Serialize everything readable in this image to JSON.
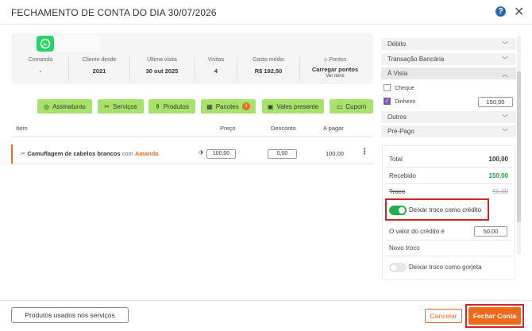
{
  "header": {
    "title": "FECHAMENTO DE CONTA DO DIA 30/07/2026",
    "help": "?",
    "close": "✕"
  },
  "client_card": {
    "stats": [
      {
        "label": "Comanda",
        "value": "-"
      },
      {
        "label": "Cliente desde",
        "value": "2021"
      },
      {
        "label": "Última visita",
        "value": "30 out 2025"
      },
      {
        "label": "Visitas",
        "value": "4"
      },
      {
        "label": "Gasto médio",
        "value": "R$ 192,50"
      }
    ],
    "points_label": "Pontos",
    "points_load": "Carregar pontos",
    "points_link": "Ver itens"
  },
  "actions": {
    "assinaturas": "Assinaturas",
    "servicos": "Serviços",
    "produtos": "Produtos",
    "pacotes": "Pacotes",
    "pacotes_count": "3",
    "vales": "Vales presente",
    "cupom": "Cupom"
  },
  "table": {
    "headers": {
      "item": "Item",
      "preco": "Preço",
      "desconto": "Desconto",
      "apagar": "A pagar"
    },
    "rows": [
      {
        "service": "Camuflagem de cabelos brancos",
        "com": "com",
        "professional": "Amanda",
        "preco": "100,00",
        "desconto": "0,00",
        "apagar": "100,00"
      }
    ]
  },
  "payment": {
    "debito": "Débito",
    "transacao": "Transação Bancária",
    "avista": "À Vista",
    "cheque": "Cheque",
    "dinheiro": "Dinheiro",
    "dinheiro_value": "150,00",
    "outros": "Outros",
    "prepago": "Pré-Pago"
  },
  "summary": {
    "total_label": "Total",
    "total_value": "100,00",
    "recebido_label": "Recebido",
    "recebido_value": "150,00",
    "troco_label": "Troco",
    "troco_value": "50,00",
    "deixar_credito": "Deixar troco como crédito",
    "valor_credito_label": "O valor do crédito é",
    "valor_credito_value": "50,00",
    "novo_troco_label": "Novo troco",
    "deixar_gorjeta": "Deixar troco como gorjeta"
  },
  "footer": {
    "produtos_usados": "Produtos usados nos serviços",
    "cancelar": "Cancelar",
    "fechar": "Fechar Conta"
  },
  "colors": {
    "accent": "#ec6a1a",
    "green_button": "#a7e36a",
    "toggle_on": "#21b04b",
    "received": "#21a047",
    "highlight": "#d32228"
  }
}
